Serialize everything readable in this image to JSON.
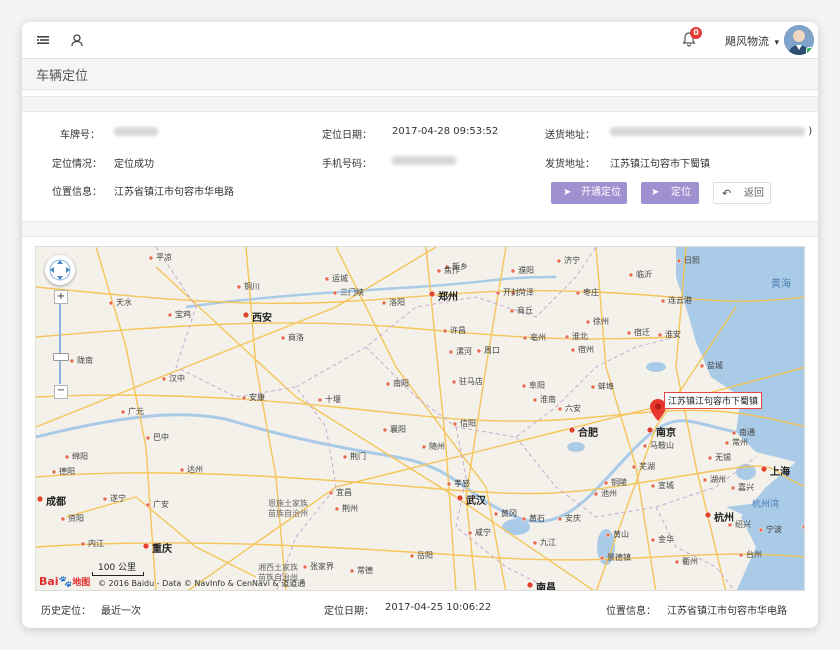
{
  "topbar": {
    "notification_count": "0",
    "user_name": "飓风物流",
    "caret": "▾"
  },
  "page": {
    "title": "车辆定位"
  },
  "info": {
    "plate_label": "车牌号：",
    "date_label": "定位日期：",
    "date_value": "2017-04-28 09:53:52",
    "delivery_label": "送货地址：",
    "delivery_suffix": ")",
    "status_label": "定位情况：",
    "status_value": "定位成功",
    "phone_label": "手机号码：",
    "ship_label": "发货地址：",
    "ship_value": "江苏镇江句容市下蜀镇",
    "pos_label": "位置信息：",
    "pos_value": "江苏省镇江市句容市华电路"
  },
  "buttons": {
    "open": "开通定位",
    "locate": "定位",
    "back": "返回"
  },
  "map": {
    "marker_label": "江苏镇江句容市下蜀镇",
    "scale": "100 公里",
    "copyright": "© 2016 Baidu - Data © NavInfo & CenNavi & 道道通",
    "logo_text": "Bai",
    "logo_text2": "地图",
    "sea_label": "黄海",
    "bay_label": "杭州湾",
    "cities": [
      {
        "name": "平凉"
      },
      {
        "name": "运城"
      },
      {
        "name": "焦作"
      },
      {
        "name": "新乡"
      },
      {
        "name": "濮阳"
      },
      {
        "name": "济宁"
      },
      {
        "name": "临沂"
      },
      {
        "name": "日照"
      },
      {
        "name": "铜川"
      },
      {
        "name": "三门峡"
      },
      {
        "name": "天水"
      },
      {
        "name": "宝鸡"
      },
      {
        "name": "西安"
      },
      {
        "name": "洛阳"
      },
      {
        "name": "郑州"
      },
      {
        "name": "开封"
      },
      {
        "name": "菏泽"
      },
      {
        "name": "枣庄"
      },
      {
        "name": "连云港"
      },
      {
        "name": "商丘"
      },
      {
        "name": "徐州"
      },
      {
        "name": "宿迁"
      },
      {
        "name": "许昌"
      },
      {
        "name": "商洛"
      },
      {
        "name": "漯河"
      },
      {
        "name": "周口"
      },
      {
        "name": "亳州"
      },
      {
        "name": "淮北"
      },
      {
        "name": "宿州"
      },
      {
        "name": "淮安"
      },
      {
        "name": "盐城"
      },
      {
        "name": "陇南"
      },
      {
        "name": "汉中"
      },
      {
        "name": "南阳"
      },
      {
        "name": "驻马店"
      },
      {
        "name": "阜阳"
      },
      {
        "name": "蚌埠"
      },
      {
        "name": "安康"
      },
      {
        "name": "十堰"
      },
      {
        "name": "淮南"
      },
      {
        "name": "广元"
      },
      {
        "name": "襄阳"
      },
      {
        "name": "信阳"
      },
      {
        "name": "六安"
      },
      {
        "name": "合肥"
      },
      {
        "name": "南京"
      },
      {
        "name": "南通"
      },
      {
        "name": "巴中"
      },
      {
        "name": "随州"
      },
      {
        "name": "马鞍山"
      },
      {
        "name": "常州"
      },
      {
        "name": "绵阳"
      },
      {
        "name": "达州"
      },
      {
        "name": "荆门"
      },
      {
        "name": "孝感"
      },
      {
        "name": "芜湖"
      },
      {
        "name": "无锡"
      },
      {
        "name": "德阳"
      },
      {
        "name": "宜昌"
      },
      {
        "name": "武汉"
      },
      {
        "name": "铜陵"
      },
      {
        "name": "宣城"
      },
      {
        "name": "上海"
      },
      {
        "name": "成都"
      },
      {
        "name": "遂宁"
      },
      {
        "name": "广安"
      },
      {
        "name": "荆州"
      },
      {
        "name": "黄冈"
      },
      {
        "name": "安庆"
      },
      {
        "name": "嘉兴"
      },
      {
        "name": "资阳"
      },
      {
        "name": "湖州"
      },
      {
        "name": "池州"
      },
      {
        "name": "杭州"
      },
      {
        "name": "内江"
      },
      {
        "name": "重庆"
      },
      {
        "name": "咸宁"
      },
      {
        "name": "黄石"
      },
      {
        "name": "九江"
      },
      {
        "name": "黄山"
      },
      {
        "name": "绍兴"
      },
      {
        "name": "宁波"
      },
      {
        "name": "舟山"
      },
      {
        "name": "岳阳"
      },
      {
        "name": "景德镇"
      },
      {
        "name": "常德"
      },
      {
        "name": "张家界"
      },
      {
        "name": "南昌"
      },
      {
        "name": "衢州"
      },
      {
        "name": "金华"
      },
      {
        "name": "台州"
      }
    ],
    "region_labels": [
      "恩施土家族",
      "苗族自治州",
      "湘西土家族",
      "苗族自治州"
    ]
  },
  "footer": {
    "history_label": "历史定位：",
    "history_value": "最近一次",
    "date_label": "定位日期：",
    "date_value": "2017-04-25 10:06:22",
    "pos_label": "位置信息：",
    "pos_value": "江苏省镇江市句容市华电路"
  }
}
